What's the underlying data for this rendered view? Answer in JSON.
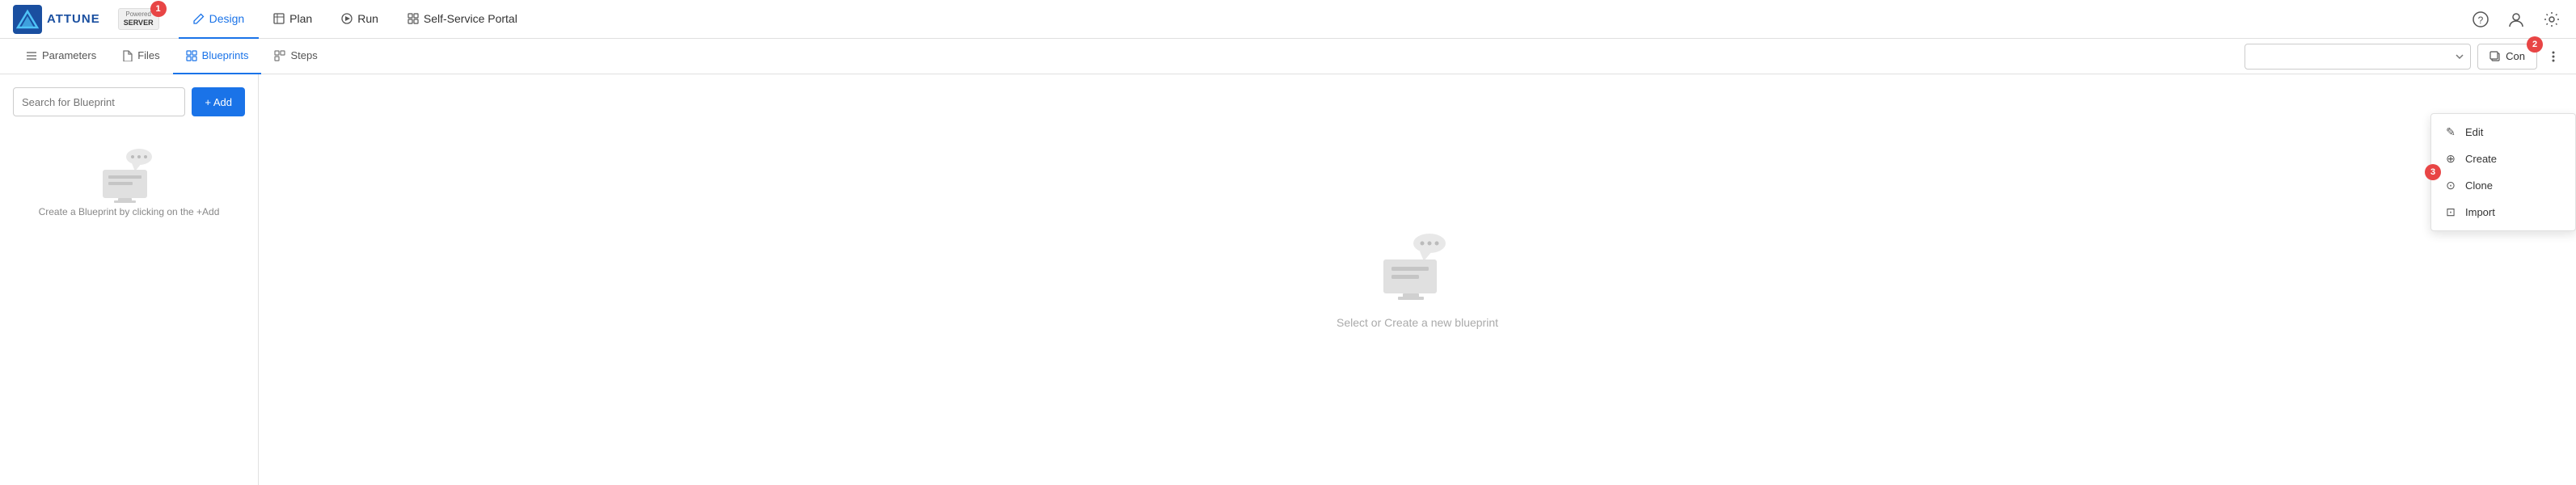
{
  "app": {
    "title": "ATTUNE"
  },
  "powered_badge": {
    "line1": "Powered",
    "line2": "SERVER",
    "badge_number": "1"
  },
  "top_nav": {
    "links": [
      {
        "label": "Design",
        "icon": "pencil",
        "active": true
      },
      {
        "label": "Plan",
        "icon": "grid"
      },
      {
        "label": "Run",
        "icon": "play"
      },
      {
        "label": "Self-Service Portal",
        "icon": "grid2"
      }
    ],
    "icons": [
      "help",
      "user",
      "settings"
    ]
  },
  "sub_nav": {
    "links": [
      {
        "label": "Parameters",
        "icon": "menu"
      },
      {
        "label": "Files",
        "icon": "file"
      },
      {
        "label": "Blueprints",
        "icon": "grid",
        "active": true
      },
      {
        "label": "Steps",
        "icon": "steps"
      }
    ],
    "dropdown_placeholder": "",
    "context_button_label": "Con",
    "context_badge": "2"
  },
  "left_panel": {
    "search_placeholder": "Search for Blueprint",
    "add_button_label": "+ Add",
    "empty_state_text": "Create a Blueprint by clicking on the +Add"
  },
  "center_panel": {
    "empty_text": "Select or Create a new blueprint"
  },
  "dropdown_menu": {
    "items": [
      {
        "label": "Edit",
        "icon": "✎"
      },
      {
        "label": "Create",
        "icon": "⊕"
      },
      {
        "label": "Clone",
        "icon": "⊙",
        "badge": "3"
      },
      {
        "label": "Import",
        "icon": "⊡"
      }
    ]
  }
}
